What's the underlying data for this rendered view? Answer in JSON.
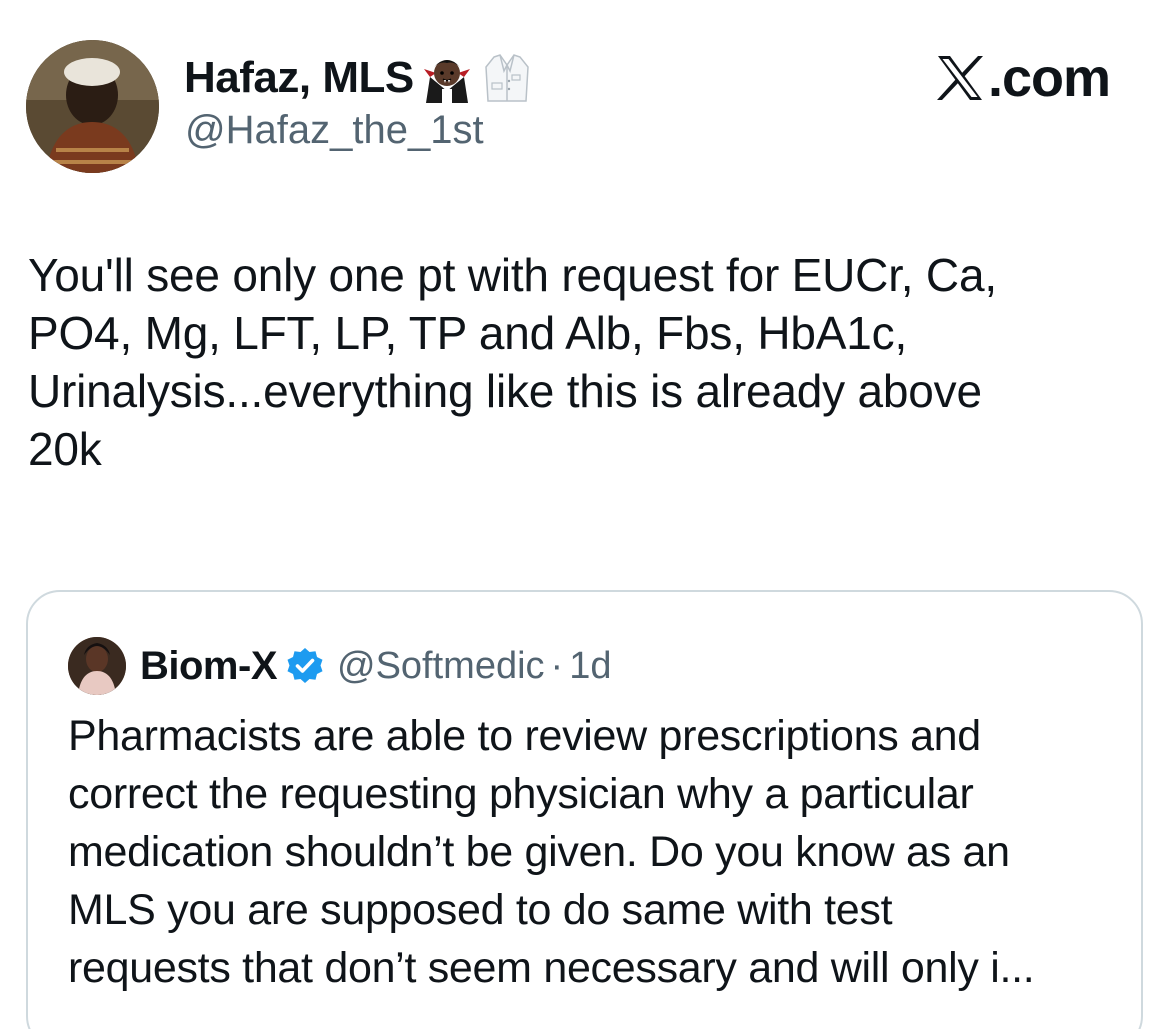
{
  "tweet": {
    "author": {
      "display_name": "Hafaz, MLS",
      "handle": "@Hafaz_the_1st",
      "name_emojis": [
        "vampire-emoji",
        "lab-coat-emoji"
      ]
    },
    "site_label": ".com",
    "text": "You'll see only one pt with request for EUCr, Ca,\nPO4, Mg, LFT, LP, TP and Alb, Fbs, HbA1c,\nUrinalysis...everything like this is already above\n20k"
  },
  "quoted_tweet": {
    "author": {
      "display_name": "Biom-X",
      "handle": "@Softmedic",
      "verified": true
    },
    "separator": "·",
    "time": "1d",
    "text": "Pharmacists are able to review prescriptions and\ncorrect the requesting physician why a particular\nmedication shouldn’t be given. Do you know as an\nMLS you are supposed to do same with test\nrequests that don’t seem necessary and will only i..."
  },
  "colors": {
    "text_primary": "#0f1419",
    "text_secondary": "#536471",
    "border": "#cfd9de",
    "verified_blue": "#1d9bf0"
  }
}
